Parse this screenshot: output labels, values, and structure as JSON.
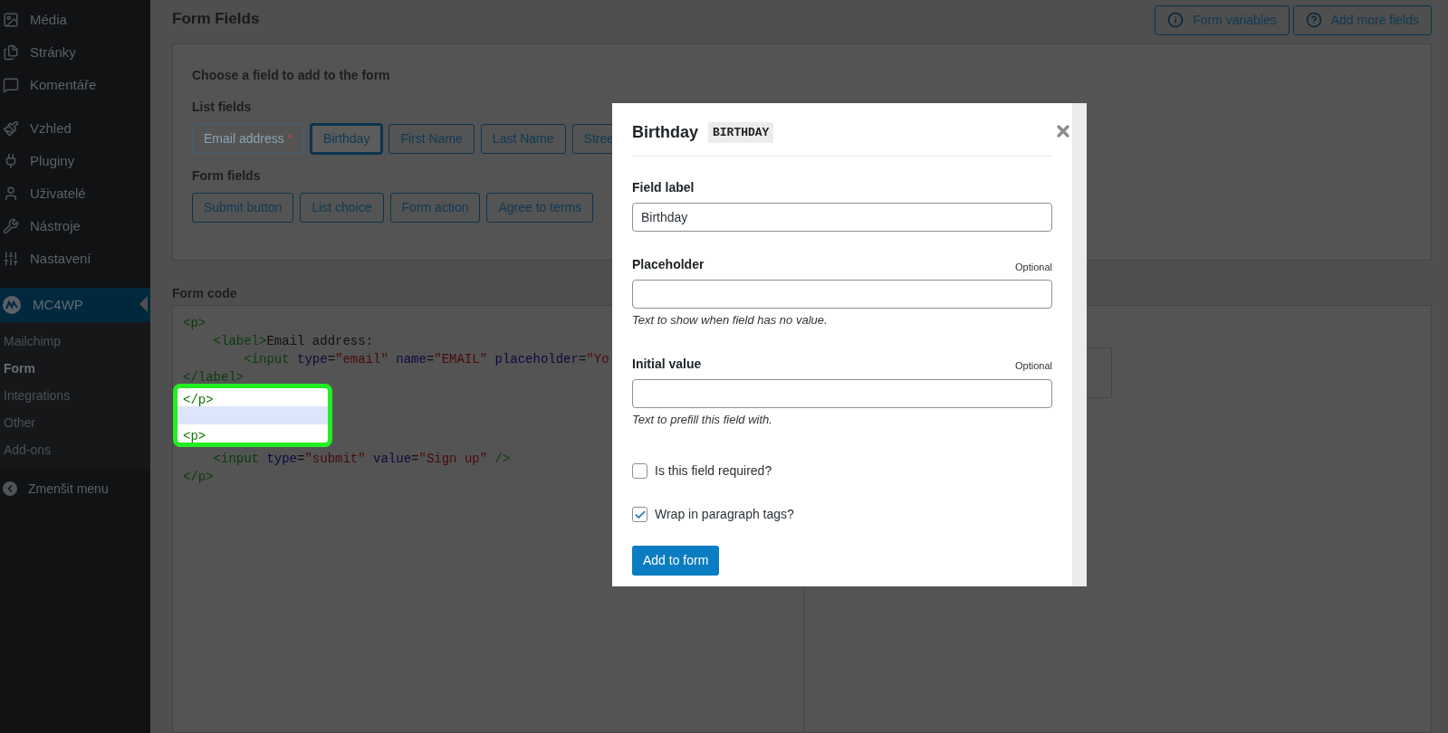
{
  "sidebar": {
    "items": [
      {
        "kind": "media",
        "label": "Média"
      },
      {
        "kind": "pages",
        "label": "Stránky"
      },
      {
        "kind": "comments",
        "label": "Komentáře"
      },
      {
        "kind": "appearance",
        "label": "Vzhled"
      },
      {
        "kind": "plugins",
        "label": "Pluginy"
      },
      {
        "kind": "users",
        "label": "Uživatelé"
      },
      {
        "kind": "tools",
        "label": "Nástroje"
      },
      {
        "kind": "settings",
        "label": "Nastavení"
      }
    ],
    "plugin": {
      "label": "MC4WP",
      "selected": true
    },
    "submenu": [
      {
        "label": "Mailchimp",
        "selected": false
      },
      {
        "label": "Form",
        "selected": true
      },
      {
        "label": "Integrations",
        "selected": false
      },
      {
        "label": "Other",
        "selected": false
      },
      {
        "label": "Add-ons",
        "selected": false
      }
    ],
    "collapse": "Zmenšit menu"
  },
  "page_title": "Form Fields",
  "header_buttons": [
    {
      "kind": "info",
      "label": "Form variables"
    },
    {
      "kind": "help",
      "label": "Add more fields"
    }
  ],
  "field_chooser": {
    "title": "Choose a field to add to the form",
    "groups": [
      {
        "heading": "List fields",
        "buttons": [
          {
            "label": "Email address",
            "required_mark": "*",
            "disabled": true,
            "selected": false
          },
          {
            "label": "Birthday",
            "disabled": false,
            "selected": true
          },
          {
            "label": "First Name",
            "disabled": false,
            "selected": false
          },
          {
            "label": "Last Name",
            "disabled": false,
            "selected": false
          },
          {
            "label": "Stree",
            "disabled": false,
            "selected": false
          }
        ]
      },
      {
        "heading": "Form fields",
        "buttons": [
          {
            "label": "Submit button",
            "disabled": false,
            "selected": false
          },
          {
            "label": "List choice",
            "disabled": false,
            "selected": false
          },
          {
            "label": "Form action",
            "disabled": false,
            "selected": false
          },
          {
            "label": "Agree to terms",
            "disabled": false,
            "selected": false
          }
        ]
      }
    ]
  },
  "form_code": {
    "heading": "Form code",
    "lines": [
      {
        "spotlight": false,
        "tokens": [
          {
            "kind": "tag",
            "text": "<p>"
          }
        ]
      },
      {
        "spotlight": false,
        "tokens": [
          {
            "kind": "tag",
            "text": "    <label>"
          },
          {
            "kind": "text",
            "text": "Email address:"
          }
        ]
      },
      {
        "spotlight": false,
        "tokens": [
          {
            "kind": "tag",
            "text": "        <input"
          },
          {
            "kind": "attr",
            "text": " type"
          },
          {
            "kind": "text",
            "text": "="
          },
          {
            "kind": "value",
            "text": "\"email\""
          },
          {
            "kind": "attr",
            "text": " name"
          },
          {
            "kind": "text",
            "text": "="
          },
          {
            "kind": "value",
            "text": "\"EMAIL\""
          },
          {
            "kind": "attr",
            "text": " placeholder"
          },
          {
            "kind": "text",
            "text": "="
          },
          {
            "kind": "value",
            "text": "\"Yo"
          }
        ]
      },
      {
        "spotlight": false,
        "tokens": [
          {
            "kind": "tag",
            "text": "</label>"
          }
        ]
      },
      {
        "spotlight": true,
        "tokens": [
          {
            "kind": "tag",
            "text": "</p>"
          }
        ]
      },
      {
        "spotlight": true,
        "active": true
      },
      {
        "spotlight": true,
        "tokens": [
          {
            "kind": "tag",
            "text": "<p>"
          }
        ]
      },
      {
        "spotlight": false,
        "tokens": [
          {
            "kind": "tag",
            "text": "    <input"
          },
          {
            "kind": "attr",
            "text": " type"
          },
          {
            "kind": "text",
            "text": "="
          },
          {
            "kind": "value",
            "text": "\"submit\""
          },
          {
            "kind": "attr",
            "text": " value"
          },
          {
            "kind": "text",
            "text": "="
          },
          {
            "kind": "value",
            "text": "\"Sign up\""
          },
          {
            "kind": "tag",
            "text": " />"
          }
        ]
      },
      {
        "spotlight": false,
        "tokens": [
          {
            "kind": "tag",
            "text": "</p>"
          }
        ]
      }
    ]
  },
  "modal": {
    "title": "Birthday",
    "tag": "BIRTHDAY",
    "fields": [
      {
        "label": "Field label",
        "value": "Birthday"
      },
      {
        "label": "Placeholder",
        "optional": "Optional",
        "help": "Text to show when field has no value."
      },
      {
        "label": "Initial value",
        "optional": "Optional",
        "help": "Text to prefill this field with."
      }
    ],
    "checkboxes": [
      {
        "label": "Is this field required?",
        "checked": false
      },
      {
        "label": "Wrap in paragraph tags?",
        "checked": true
      }
    ],
    "submit": "Add to form"
  }
}
